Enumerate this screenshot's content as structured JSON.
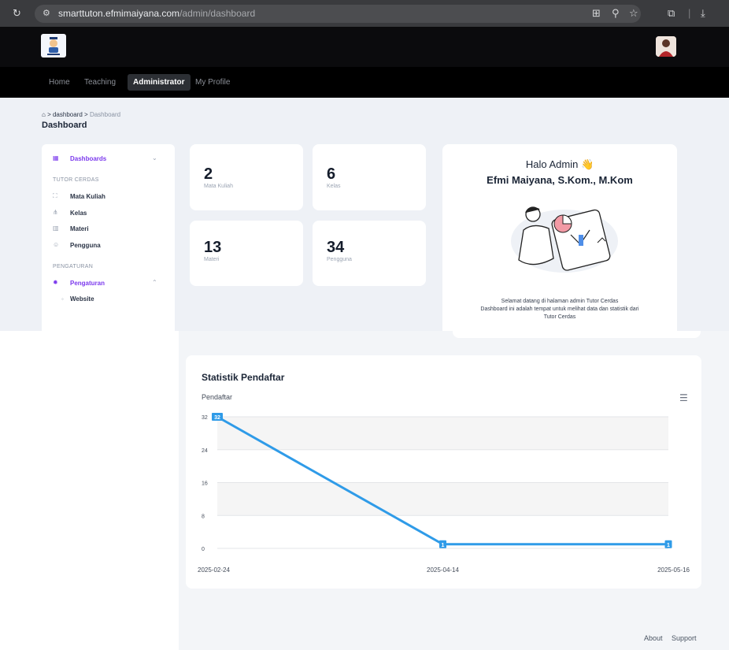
{
  "browser": {
    "url_host": "smarttuton.efmimaiyana.com",
    "url_path": "/admin/dashboard"
  },
  "nav": {
    "items": [
      {
        "label": "Home",
        "active": false
      },
      {
        "label": "Teaching",
        "active": false
      },
      {
        "label": "Administrator",
        "active": true
      },
      {
        "label": "My Profile",
        "active": false
      }
    ]
  },
  "breadcrumb": {
    "first": "dashboard",
    "sep": ">",
    "current": "Dashboard"
  },
  "page_title": "Dashboard",
  "sidebar": {
    "dashboards_label": "Dashboards",
    "section1": "TUTOR CERDAS",
    "items": [
      {
        "label": "Mata Kuliah",
        "icon": "course-icon"
      },
      {
        "label": "Kelas",
        "icon": "class-icon"
      },
      {
        "label": "Materi",
        "icon": "material-icon"
      },
      {
        "label": "Pengguna",
        "icon": "users-icon"
      }
    ],
    "section2": "PENGATURAN",
    "settings_label": "Pengaturan",
    "sub_items": [
      {
        "label": "Website"
      }
    ],
    "accent_color": "#7c3aed"
  },
  "stats": [
    {
      "value": "2",
      "label": "Mata Kuliah"
    },
    {
      "value": "6",
      "label": "Kelas"
    },
    {
      "value": "13",
      "label": "Materi"
    },
    {
      "value": "34",
      "label": "Pengguna"
    }
  ],
  "welcome": {
    "hello": "Halo Admin",
    "emoji": "👋",
    "name": "Efmi Maiyana, S.Kom., M.Kom",
    "line1": "Selamat datang di halaman admin Tutor Cerdas",
    "line2": "Dashboard ini adalah tempat untuk melihat data dan statistik dari",
    "line3": "Tutor Cerdas"
  },
  "chart_section": {
    "title": "Statistik Pendaftar",
    "menu_icon": "hamburger-menu-icon"
  },
  "chart_data": {
    "type": "line",
    "title": "Pendaftar",
    "x": [
      "2025-02-24",
      "2025-04-14",
      "2025-05-16"
    ],
    "series": [
      {
        "name": "Pendaftar",
        "values": [
          32,
          1,
          1
        ]
      }
    ],
    "ylim": [
      0,
      32
    ],
    "yticks": [
      0,
      8,
      16,
      24,
      32
    ],
    "grid": true,
    "line_color": "#2f9be8"
  },
  "footer": {
    "about": "About",
    "support": "Support"
  }
}
